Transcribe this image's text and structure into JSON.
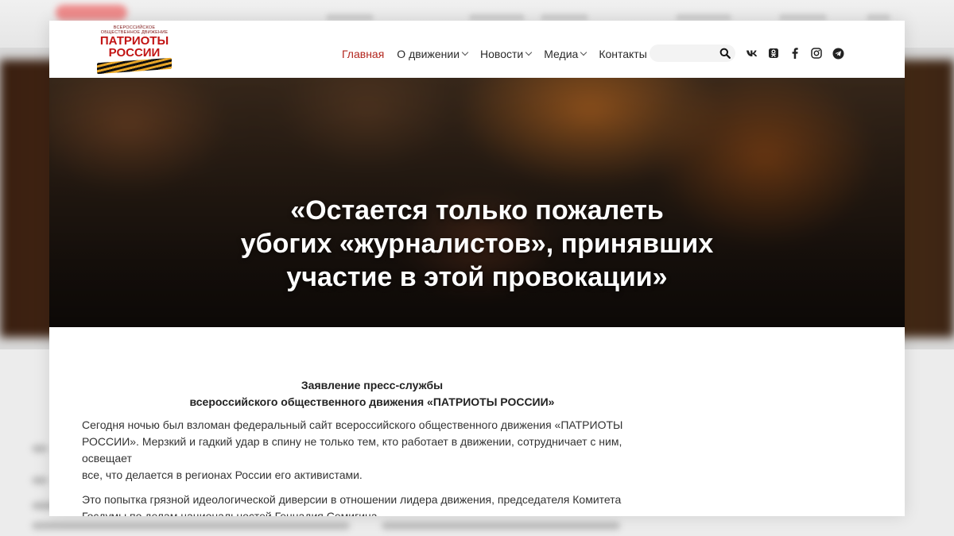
{
  "header": {
    "logo": {
      "subtitle": "ВСЕРОССИЙСКОЕ ОБЩЕСТВЕННОЕ ДВИЖЕНИЕ",
      "title_line1": "ПАТРИОТЫ",
      "title_line2": "РОССИИ"
    },
    "nav": [
      {
        "label": "Главная",
        "active": true,
        "has_dropdown": false
      },
      {
        "label": "О движении",
        "active": false,
        "has_dropdown": true
      },
      {
        "label": "Новости",
        "active": false,
        "has_dropdown": true
      },
      {
        "label": "Медиа",
        "active": false,
        "has_dropdown": true
      },
      {
        "label": "Контакты",
        "active": false,
        "has_dropdown": false
      }
    ],
    "search": {
      "value": "",
      "placeholder": ""
    },
    "social": [
      "vk-icon",
      "odnoklassniki-icon",
      "facebook-icon",
      "instagram-icon",
      "telegram-icon"
    ],
    "accent_color": "#b3261e"
  },
  "hero": {
    "title_lines": [
      "«Остается только пожалеть",
      "убогих «журналистов», принявших",
      "участие в этой провокации»"
    ]
  },
  "article": {
    "statement_lines": [
      "Заявление пресс-службы",
      "всероссийского общественного движения «ПАТРИОТЫ РОССИИ»"
    ],
    "paragraphs": [
      [
        "Сегодня ночью был взломан федеральный сайт всероссийского общественного движения «ПАТРИОТЫ",
        "РОССИИ». Мерзкий и гадкий удар в спину не только тем, кто работает в движении, сотрудничает с ним, освещает",
        "все, что делается в регионах России его активистами."
      ],
      [
        "Это попытка грязной идеологической диверсии в отношении лидера движения, председателя Комитета",
        "Госдумы по делам национальностей Геннадия Семигина."
      ]
    ]
  }
}
